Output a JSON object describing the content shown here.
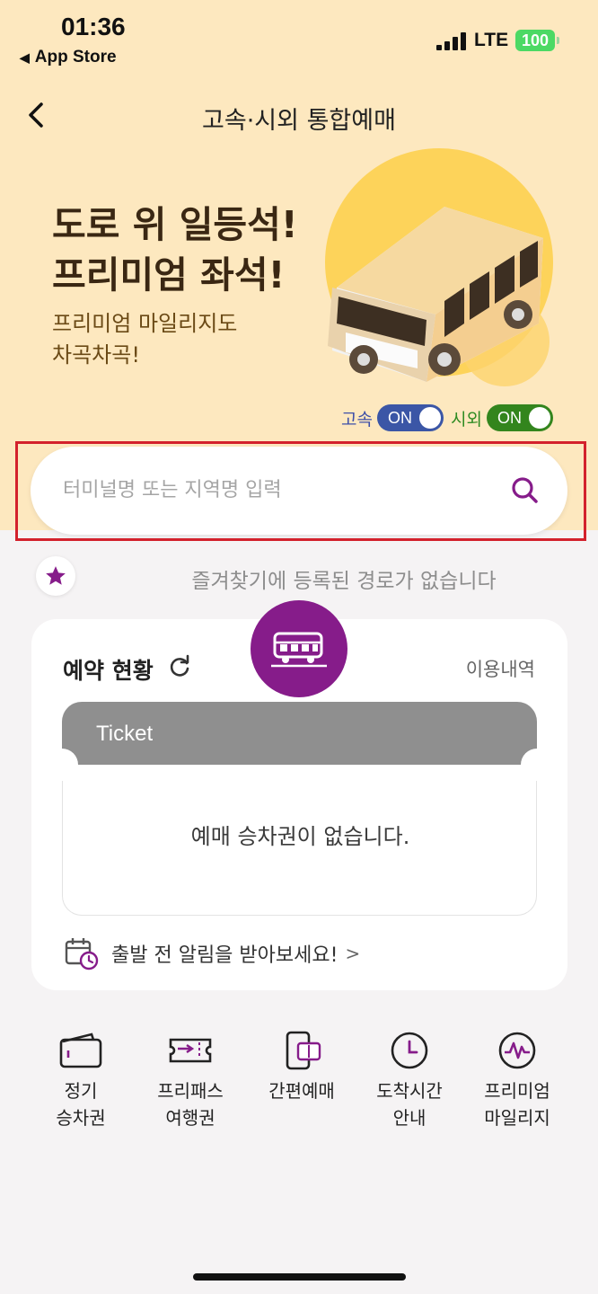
{
  "status_bar": {
    "time": "01:36",
    "back_app": "App Store",
    "network": "LTE",
    "battery": "100"
  },
  "header": {
    "title": "고속·시외 통합예매"
  },
  "banner": {
    "headline_line1": "도로 위 일등석!",
    "headline_line2": "프리미엄 좌석!",
    "sub_line1": "프리미엄 마일리지도",
    "sub_line2": "차곡차곡!"
  },
  "toggles": {
    "express": {
      "label": "고속",
      "state": "ON"
    },
    "intercity": {
      "label": "시외",
      "state": "ON"
    }
  },
  "search": {
    "placeholder": "터미널명 또는 지역명 입력"
  },
  "favorites": {
    "empty_text": "즐겨찾기에 등록된 경로가 없습니다"
  },
  "reservation": {
    "title": "예약 현황",
    "history_link": "이용내역",
    "ticket_label": "Ticket",
    "empty_text": "예매 승차권이 없습니다.",
    "alarm_text": "출발 전 알림을 받아보세요!",
    "alarm_chevron": ">"
  },
  "quick_menu": [
    {
      "label": "정기\n승차권",
      "icon": "wallet-icon"
    },
    {
      "label": "프리패스\n여행권",
      "icon": "ticket-pass-icon"
    },
    {
      "label": "간편예매",
      "icon": "phone-ticket-icon"
    },
    {
      "label": "도착시간\n안내",
      "icon": "clock-icon"
    },
    {
      "label": "프리미엄\n마일리지",
      "icon": "mileage-icon"
    }
  ],
  "colors": {
    "banner_bg": "#fde8bf",
    "brand_purple": "#861c8a",
    "express_blue": "#3b56a6",
    "intercity_green": "#33851d",
    "highlight_red": "#d3212c"
  }
}
